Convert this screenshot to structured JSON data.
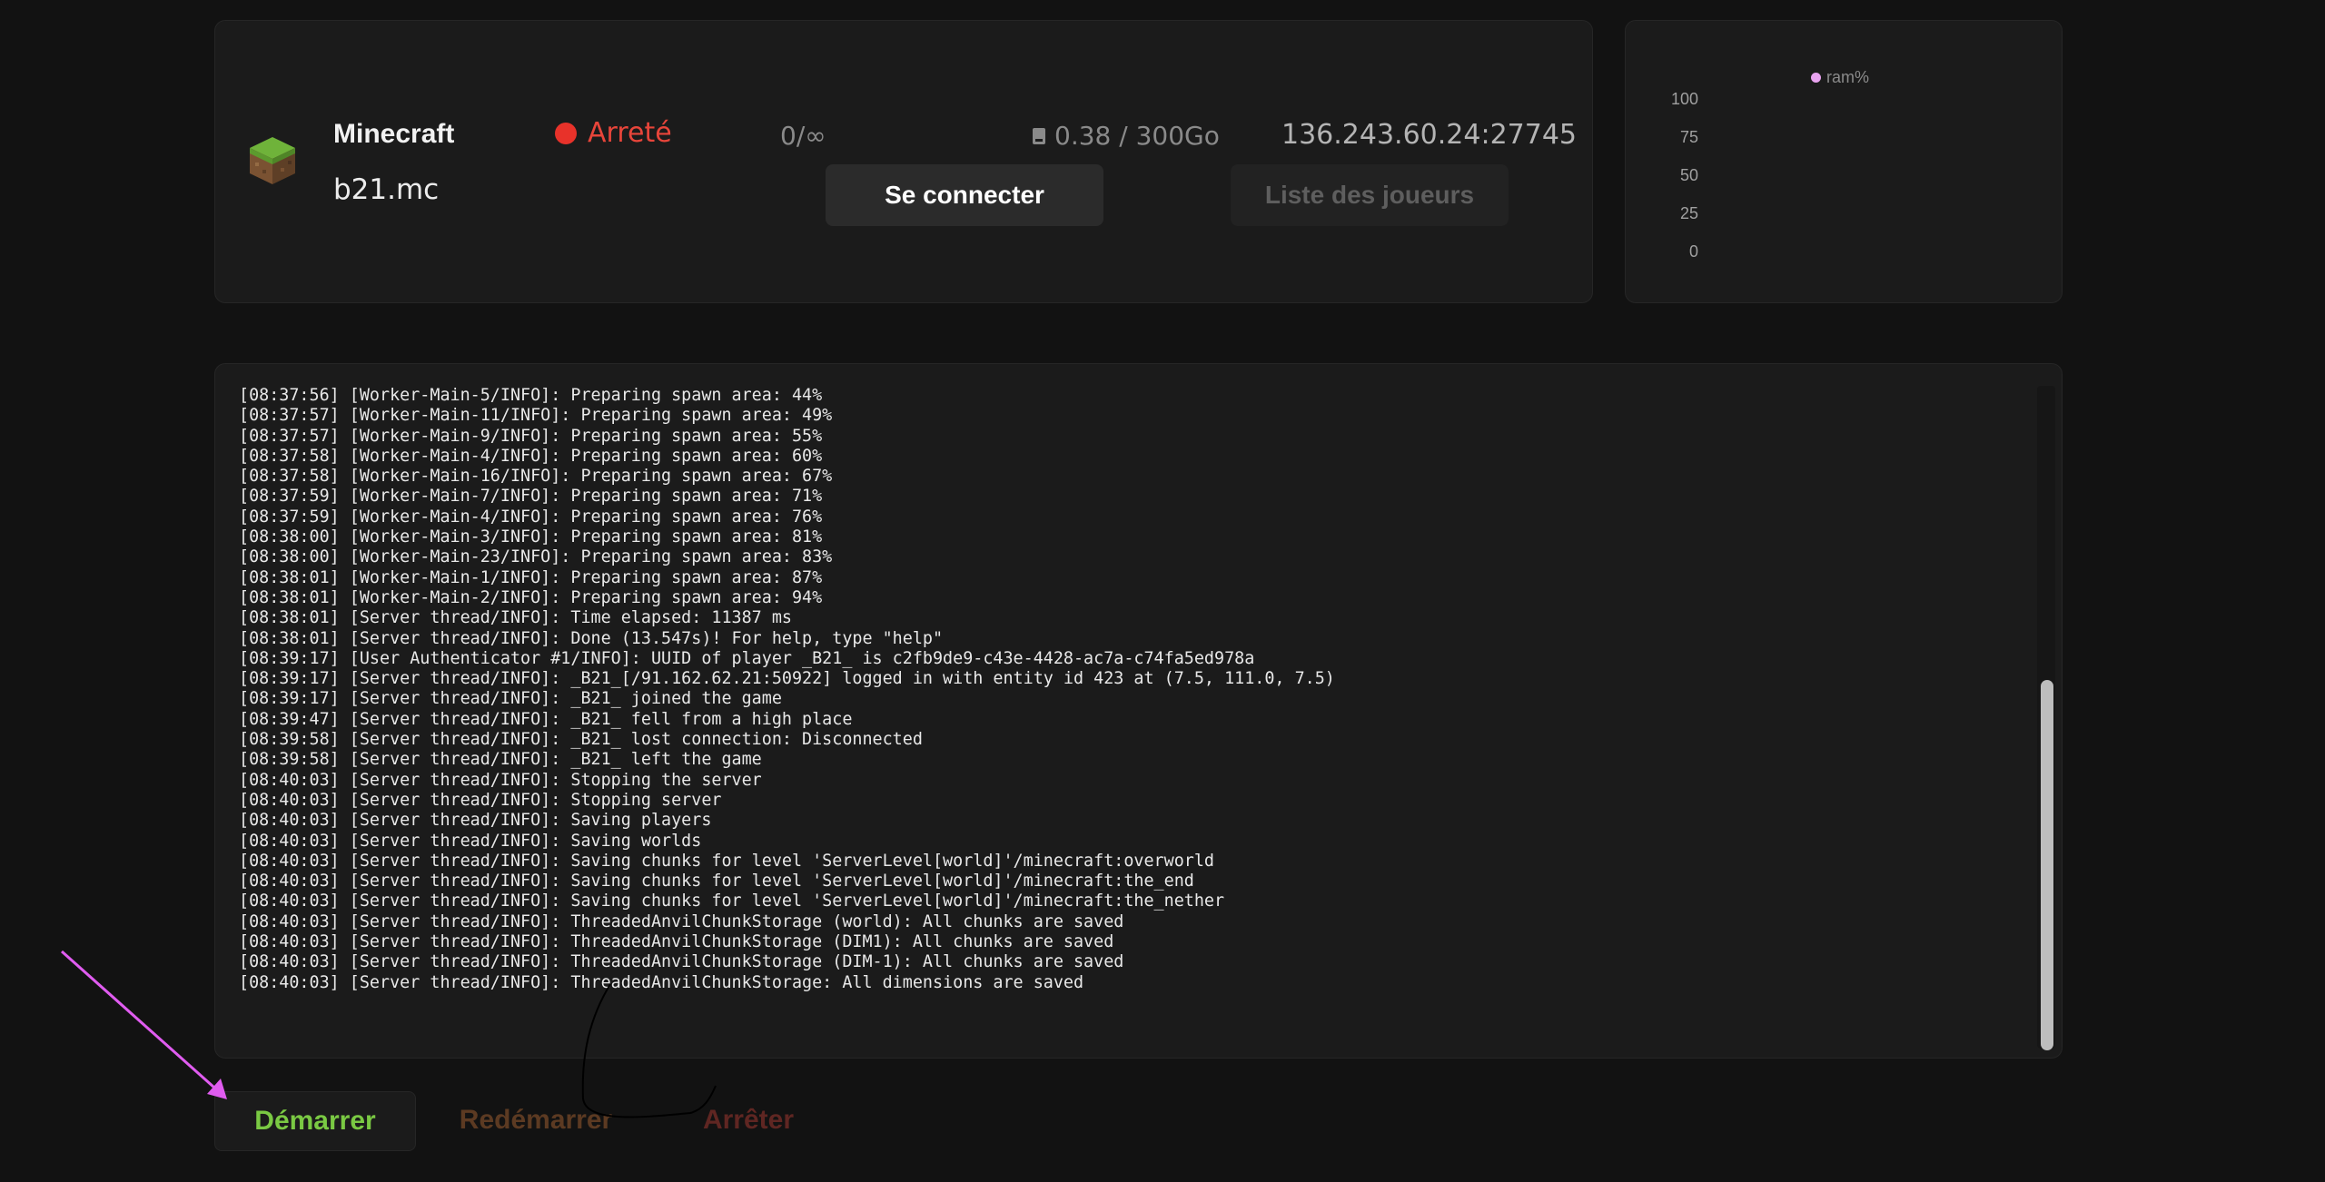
{
  "server": {
    "name": "Minecraft",
    "host": "b21.mc",
    "status": "Arreté",
    "status_color": "#e8322a",
    "players": "0/∞",
    "storage": "0.38 / 300Go",
    "address": "136.243.60.24:27745",
    "connect_label": "Se connecter",
    "players_list_label": "Liste des joueurs",
    "icon": "minecraft-grass-block-icon"
  },
  "chart_data": {
    "type": "line",
    "series": [
      {
        "name": "ram%",
        "values": []
      }
    ],
    "yticks": [
      "100",
      "75",
      "50",
      "25",
      "0"
    ],
    "ylim": [
      0,
      100
    ],
    "legend_position": "top",
    "legend_color": "#e9a3f0"
  },
  "console": {
    "lines": [
      "[08:37:56] [Worker-Main-5/INFO]: Preparing spawn area: 44%",
      "[08:37:57] [Worker-Main-11/INFO]: Preparing spawn area: 49%",
      "[08:37:57] [Worker-Main-9/INFO]: Preparing spawn area: 55%",
      "[08:37:58] [Worker-Main-4/INFO]: Preparing spawn area: 60%",
      "[08:37:58] [Worker-Main-16/INFO]: Preparing spawn area: 67%",
      "[08:37:59] [Worker-Main-7/INFO]: Preparing spawn area: 71%",
      "[08:37:59] [Worker-Main-4/INFO]: Preparing spawn area: 76%",
      "[08:38:00] [Worker-Main-3/INFO]: Preparing spawn area: 81%",
      "[08:38:00] [Worker-Main-23/INFO]: Preparing spawn area: 83%",
      "[08:38:01] [Worker-Main-1/INFO]: Preparing spawn area: 87%",
      "[08:38:01] [Worker-Main-2/INFO]: Preparing spawn area: 94%",
      "[08:38:01] [Server thread/INFO]: Time elapsed: 11387 ms",
      "[08:38:01] [Server thread/INFO]: Done (13.547s)! For help, type \"help\"",
      "[08:39:17] [User Authenticator #1/INFO]: UUID of player _B21_ is c2fb9de9-c43e-4428-ac7a-c74fa5ed978a",
      "[08:39:17] [Server thread/INFO]: _B21_[/91.162.62.21:50922] logged in with entity id 423 at (7.5, 111.0, 7.5)",
      "[08:39:17] [Server thread/INFO]: _B21_ joined the game",
      "[08:39:47] [Server thread/INFO]: _B21_ fell from a high place",
      "[08:39:58] [Server thread/INFO]: _B21_ lost connection: Disconnected",
      "[08:39:58] [Server thread/INFO]: _B21_ left the game",
      "[08:40:03] [Server thread/INFO]: Stopping the server",
      "[08:40:03] [Server thread/INFO]: Stopping server",
      "[08:40:03] [Server thread/INFO]: Saving players",
      "[08:40:03] [Server thread/INFO]: Saving worlds",
      "[08:40:03] [Server thread/INFO]: Saving chunks for level 'ServerLevel[world]'/minecraft:overworld",
      "[08:40:03] [Server thread/INFO]: Saving chunks for level 'ServerLevel[world]'/minecraft:the_end",
      "[08:40:03] [Server thread/INFO]: Saving chunks for level 'ServerLevel[world]'/minecraft:the_nether",
      "[08:40:03] [Server thread/INFO]: ThreadedAnvilChunkStorage (world): All chunks are saved",
      "[08:40:03] [Server thread/INFO]: ThreadedAnvilChunkStorage (DIM1): All chunks are saved",
      "[08:40:03] [Server thread/INFO]: ThreadedAnvilChunkStorage (DIM-1): All chunks are saved",
      "[08:40:03] [Server thread/INFO]: ThreadedAnvilChunkStorage: All dimensions are saved"
    ]
  },
  "actions": {
    "start_label": "Démarrer",
    "restart_label": "Redémarrer",
    "stop_label": "Arrêter",
    "start_color": "#7ac943"
  },
  "annotation": {
    "arrow_color": "#e05cf0",
    "arrow_icon": "arrow-pointer-icon"
  }
}
